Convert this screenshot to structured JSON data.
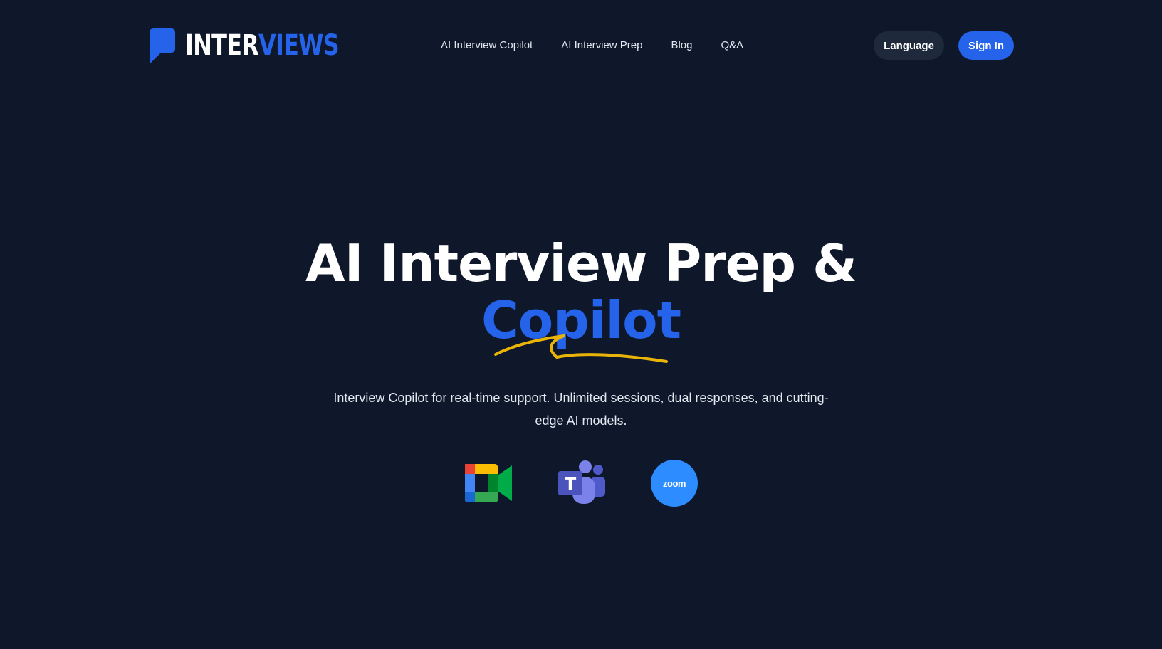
{
  "header": {
    "logo": {
      "part1": "INTER",
      "part2": "VIEWS",
      "icon": "speech-bubble-icon"
    },
    "nav": [
      {
        "label": "AI Interview Copilot"
      },
      {
        "label": "AI Interview Prep"
      },
      {
        "label": "Blog"
      },
      {
        "label": "Q&A"
      }
    ],
    "language_label": "Language",
    "signin_label": "Sign In"
  },
  "hero": {
    "title_line1": "AI Interview Prep &",
    "title_line2": "Copilot",
    "subtitle": "Interview Copilot for real-time support. Unlimited sessions, dual responses, and cutting-edge AI models.",
    "platforms": [
      {
        "name": "google-meet-icon"
      },
      {
        "name": "microsoft-teams-icon"
      },
      {
        "name": "zoom-icon",
        "label": "zoom"
      }
    ]
  },
  "colors": {
    "background": "#0f172a",
    "accent": "#2563eb",
    "underline": "#eab308",
    "secondary_button": "#1e293b"
  }
}
